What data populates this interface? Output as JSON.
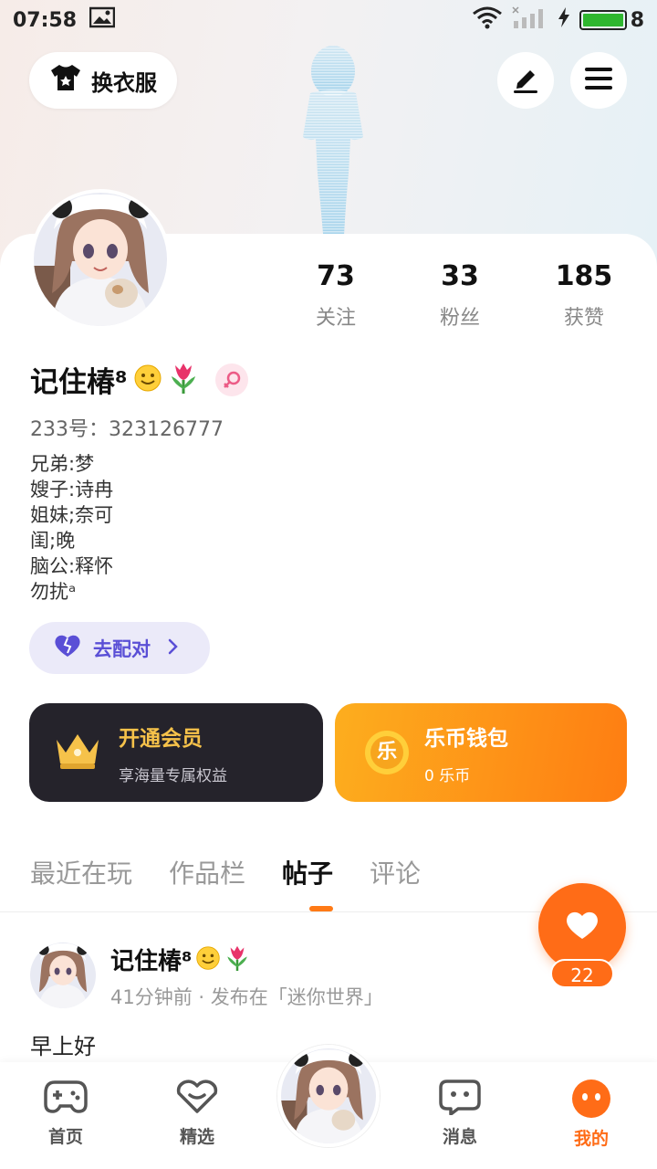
{
  "status": {
    "time": "07:58",
    "battery": "8"
  },
  "header": {
    "outfit_label": "换衣服"
  },
  "stats": [
    {
      "num": "73",
      "label": "关注"
    },
    {
      "num": "33",
      "label": "粉丝"
    },
    {
      "num": "185",
      "label": "获赞"
    }
  ],
  "profile": {
    "name": "记住椿⁸",
    "uid": "233号：323126777",
    "bio": [
      "兄弟:梦",
      "嫂子:诗冉",
      "姐妹;奈可",
      "闺;晚",
      "脑公:释怀",
      "勿扰ᵃ"
    ]
  },
  "match": {
    "label": "去配对"
  },
  "vip": {
    "title": "开通会员",
    "subtitle": "享海量专属权益"
  },
  "wallet": {
    "title": "乐币钱包",
    "subtitle": "0 乐币",
    "coin": "乐"
  },
  "tabs": [
    "最近在玩",
    "作品栏",
    "帖子",
    "评论"
  ],
  "post": {
    "author": "记住椿⁸",
    "meta": "41分钟前 · 发布在「迷你世界」",
    "text": "早上好",
    "likes": "22"
  },
  "nav": [
    {
      "label": "首页"
    },
    {
      "label": "精选"
    },
    {
      "label": "消息"
    },
    {
      "label": "我的"
    }
  ],
  "colors": {
    "accent": "#ff6c17",
    "match": "#5a4fd6",
    "vip_bg": "#25232b"
  }
}
